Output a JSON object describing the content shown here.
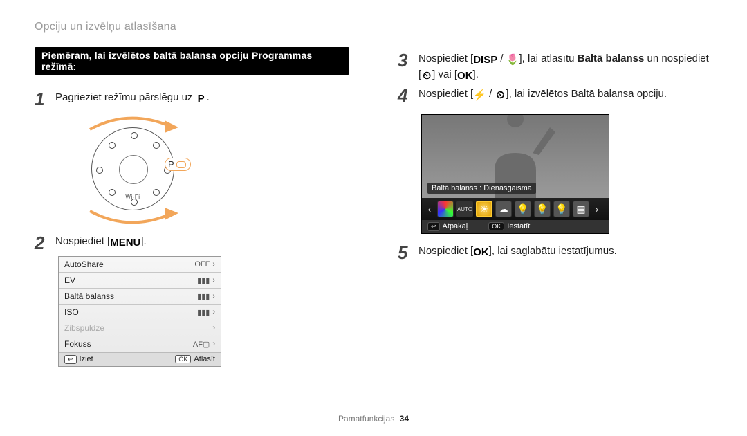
{
  "heading": "Opciju un izvēlņu atlasīšana",
  "lead_bar": "Piemēram, lai izvēlētos baltā balansa opciju Programmas režīmā:",
  "dial": {
    "p_label": "P",
    "wifi": "Wi-Fi"
  },
  "steps": {
    "s1_pre": "Pagrieziet režīmu pārslēgu uz ",
    "s1_icon": "P",
    "s1_post": ".",
    "s2_pre": "Nospiediet [",
    "s2_icon": "MENU",
    "s2_post": "].",
    "s3_a": "Nospiediet [",
    "s3_disp": "DISP",
    "s3_slash": " / ",
    "s3_macro": "🌷",
    "s3_b": "], lai atlasītu ",
    "s3_bold": "Baltā balanss",
    "s3_c": " un nospiediet [",
    "s3_timer": "⏲",
    "s3_d": "] vai [",
    "s3_ok": "OK",
    "s3_e": "].",
    "s4_a": "Nospiediet [",
    "s4_flash": "⚡",
    "s4_slash": " / ",
    "s4_timer": "⏲",
    "s4_b": "], lai izvēlētos Baltā balansa opciju.",
    "s5_a": "Nospiediet [",
    "s5_ok": "OK",
    "s5_b": "], lai saglabātu iestatījumus."
  },
  "menu": {
    "rows": [
      {
        "label": "AutoShare",
        "value": "OFF"
      },
      {
        "label": "EV",
        "value": "▮▮▮"
      },
      {
        "label": "Baltā balanss",
        "value": "▮▮▮"
      },
      {
        "label": "ISO",
        "value": "▮▮▮"
      },
      {
        "label": "Zibspuldze",
        "value": "",
        "disabled": true
      },
      {
        "label": "Fokuss",
        "value": "AF▢"
      }
    ],
    "footer_left_btn": "↩",
    "footer_left": "Iziet",
    "footer_right_btn": "OK",
    "footer_right": "Atlasīt"
  },
  "wb": {
    "label": "Baltā balanss : Dienasgaisma",
    "footer_left_btn": "↩",
    "footer_left": "Atpakaļ",
    "footer_right_btn": "OK",
    "footer_right": "Iestatīt"
  },
  "footer": {
    "section": "Pamatfunkcijas",
    "page": "34"
  }
}
